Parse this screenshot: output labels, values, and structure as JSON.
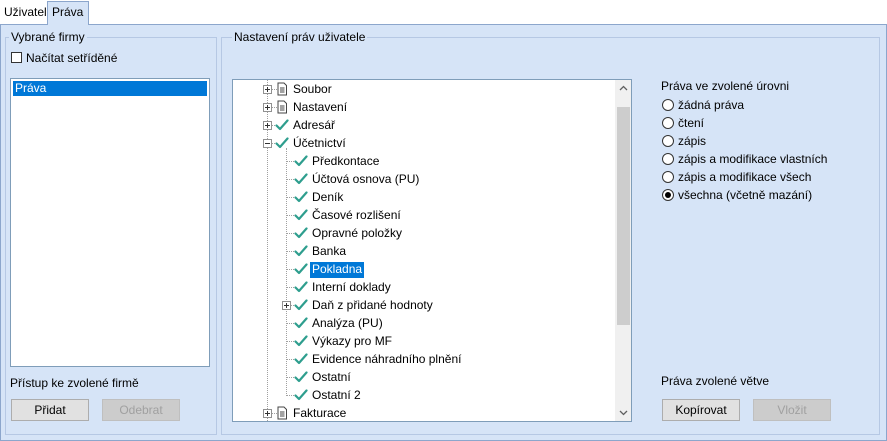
{
  "tabs": [
    {
      "label": "Uživatel",
      "active": false
    },
    {
      "label": "Práva",
      "active": true
    }
  ],
  "left": {
    "group_label": "Vybrané firmy",
    "sorted_checkbox_label": "Načítat setříděné",
    "sorted_checked": false,
    "list_items": [
      "Práva"
    ],
    "access_label": "Přístup ke zvolené firmě",
    "add_button": "Přidat",
    "remove_button": "Odebrat"
  },
  "right": {
    "group_label": "Nastavení práv uživatele",
    "tree": [
      {
        "label": "Soubor",
        "icon": "document-icon",
        "expander": "plus",
        "level": 0
      },
      {
        "label": "Nastavení",
        "icon": "document-icon",
        "expander": "plus",
        "level": 0
      },
      {
        "label": "Adresář",
        "icon": "check-icon",
        "expander": "plus",
        "level": 0
      },
      {
        "label": "Účetnictví",
        "icon": "check-icon",
        "expander": "minus",
        "level": 0
      },
      {
        "label": "Předkontace",
        "icon": "check-icon",
        "expander": "none",
        "level": 1
      },
      {
        "label": "Účtová osnova (PU)",
        "icon": "check-icon",
        "expander": "none",
        "level": 1
      },
      {
        "label": "Deník",
        "icon": "check-icon",
        "expander": "none",
        "level": 1
      },
      {
        "label": "Časové rozlišení",
        "icon": "check-icon",
        "expander": "none",
        "level": 1
      },
      {
        "label": "Opravné položky",
        "icon": "check-icon",
        "expander": "none",
        "level": 1
      },
      {
        "label": "Banka",
        "icon": "check-icon",
        "expander": "none",
        "level": 1
      },
      {
        "label": "Pokladna",
        "icon": "check-icon",
        "expander": "none",
        "level": 1,
        "selected": true
      },
      {
        "label": "Interní doklady",
        "icon": "check-icon",
        "expander": "none",
        "level": 1
      },
      {
        "label": "Daň z přidané hodnoty",
        "icon": "check-icon",
        "expander": "plus",
        "level": 1
      },
      {
        "label": "Analýza (PU)",
        "icon": "check-icon",
        "expander": "none",
        "level": 1
      },
      {
        "label": "Výkazy pro MF",
        "icon": "check-icon",
        "expander": "none",
        "level": 1
      },
      {
        "label": "Evidence náhradního plnění",
        "icon": "check-icon",
        "expander": "none",
        "level": 1
      },
      {
        "label": "Ostatní",
        "icon": "check-icon",
        "expander": "none",
        "level": 1
      },
      {
        "label": "Ostatní 2",
        "icon": "check-icon",
        "expander": "none",
        "level": 1
      },
      {
        "label": "Fakturace",
        "icon": "document-icon",
        "expander": "plus",
        "level": 0
      }
    ],
    "rights_label": "Práva ve zvolené úrovni",
    "rights_options": [
      {
        "label": "žádná práva",
        "checked": false
      },
      {
        "label": "čtení",
        "checked": false
      },
      {
        "label": "zápis",
        "checked": false
      },
      {
        "label": "zápis a modifikace vlastních",
        "checked": false
      },
      {
        "label": "zápis a modifikace všech",
        "checked": false
      },
      {
        "label": "všechna (včetně mazání)",
        "checked": true
      }
    ],
    "branch_label": "Práva zvolené větve",
    "copy_button": "Kopírovat",
    "paste_button": "Vložit"
  },
  "colors": {
    "panel_bg": "#d6e4f7",
    "selection": "#0078d7",
    "check_green": "#2e9e8e"
  }
}
